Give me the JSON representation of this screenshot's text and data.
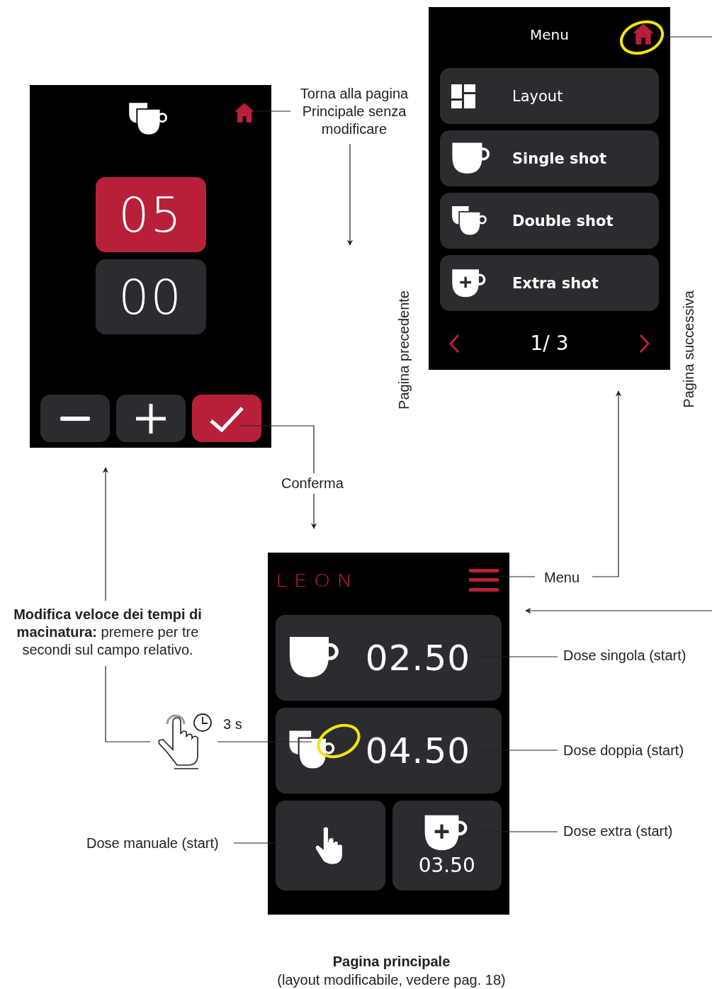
{
  "edit_screen": {
    "value_fields": [
      {
        "value": "05",
        "selected": true
      },
      {
        "value": "00",
        "selected": false
      }
    ],
    "buttons": [
      {
        "kind": "minus"
      },
      {
        "kind": "plus"
      },
      {
        "kind": "confirm"
      }
    ]
  },
  "menu_screen": {
    "title": "Menu",
    "items": [
      {
        "kind": "layout",
        "label": "Layout"
      },
      {
        "kind": "single",
        "label": "Single shot"
      },
      {
        "kind": "double",
        "label": "Double shot"
      },
      {
        "kind": "extra",
        "label": "Extra shot"
      }
    ],
    "page": "1/ 3"
  },
  "main_screen": {
    "logo": "LEON",
    "doses": [
      {
        "kind": "single",
        "value": "02.50"
      },
      {
        "kind": "double",
        "value": "04.50"
      }
    ],
    "tiles": [
      {
        "kind": "manual"
      },
      {
        "kind": "extra",
        "value": "03.50"
      }
    ]
  },
  "annotations": {
    "home_note": "Torna alla pagina Principale senza modificare",
    "confirm": "Conferma",
    "previous_page": "Pagina precedente",
    "next_page": "Pagina successiva",
    "menu": "Menu",
    "quick_edit": "**Modifica veloce dei tempi di macinatura:** premere per tre secondi sul campo relativo.",
    "hold_time": "3 s",
    "single_dose": "Dose singola (start)",
    "double_dose": "Dose doppia (start)",
    "manual_dose": "Dose manuale (start)",
    "extra_dose": "Dose extra (start)"
  },
  "caption": {
    "title": "Pagina principale",
    "subtitle": "(layout modificabile, vedere pag. 18)"
  }
}
